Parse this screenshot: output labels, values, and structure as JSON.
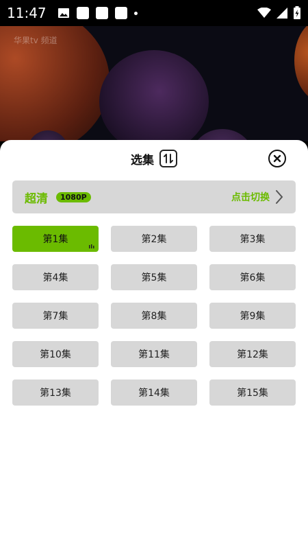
{
  "statusbar": {
    "time": "11:47"
  },
  "video": {
    "watermark": "华果tv 频道"
  },
  "sheet": {
    "title": "选集",
    "quality": {
      "label": "超清",
      "badge": "1080P",
      "switch_label": "点击切换"
    },
    "episodes": [
      {
        "label": "第1集",
        "active": true
      },
      {
        "label": "第2集"
      },
      {
        "label": "第3集"
      },
      {
        "label": "第4集"
      },
      {
        "label": "第5集"
      },
      {
        "label": "第6集"
      },
      {
        "label": "第7集"
      },
      {
        "label": "第8集"
      },
      {
        "label": "第9集"
      },
      {
        "label": "第10集"
      },
      {
        "label": "第11集"
      },
      {
        "label": "第12集"
      },
      {
        "label": "第13集"
      },
      {
        "label": "第14集"
      },
      {
        "label": "第15集"
      }
    ]
  },
  "colors": {
    "accent": "#6bbb00",
    "tile": "#d7d7d7"
  }
}
